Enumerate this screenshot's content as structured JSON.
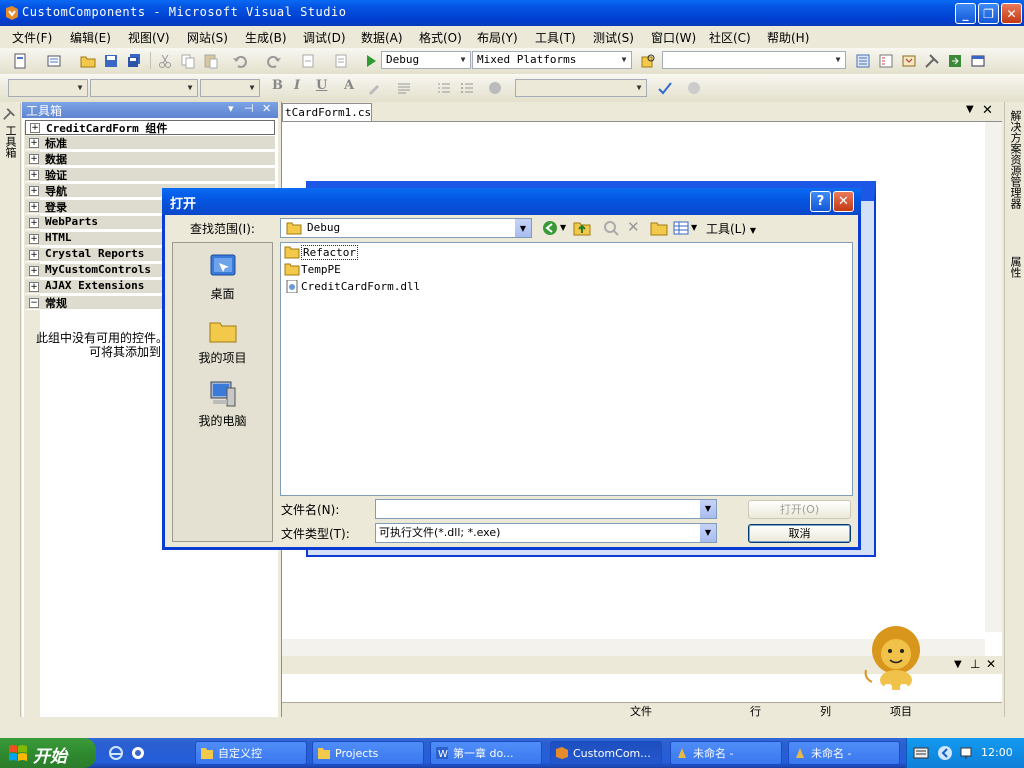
{
  "window": {
    "title": "CustomComponents - Microsoft Visual Studio"
  },
  "menu": [
    "文件(F)",
    "编辑(E)",
    "视图(V)",
    "网站(S)",
    "生成(B)",
    "调试(D)",
    "数据(A)",
    "格式(O)",
    "布局(Y)",
    "工具(T)",
    "测试(S)",
    "窗口(W)",
    "社区(C)",
    "帮助(H)"
  ],
  "toolbar": {
    "config": "Debug",
    "platform": "Mixed Platforms"
  },
  "toolbox": {
    "title": "工具箱",
    "side_tab": "工具箱",
    "groups": [
      {
        "label": "CreditCardForm 组件",
        "expanded": false
      },
      {
        "label": "标准",
        "expanded": false
      },
      {
        "label": "数据",
        "expanded": false
      },
      {
        "label": "验证",
        "expanded": false
      },
      {
        "label": "导航",
        "expanded": false
      },
      {
        "label": "登录",
        "expanded": false
      },
      {
        "label": "WebParts",
        "expanded": false
      },
      {
        "label": "HTML",
        "expanded": false
      },
      {
        "label": "Crystal Reports",
        "expanded": false
      },
      {
        "label": "MyCustomControls",
        "expanded": false
      },
      {
        "label": "AJAX Extensions",
        "expanded": false
      },
      {
        "label": "常规",
        "expanded": true
      }
    ],
    "empty_line1": "此组中没有可用的控件。",
    "empty_line2": "可将其添加到"
  },
  "editor": {
    "tab": "tCardForm1.cs"
  },
  "right_tabs": {
    "solution": "解决方案资源管理器",
    "properties": "属性"
  },
  "bottom_panel": {
    "columns": [
      "文件",
      "行",
      "列",
      "项目"
    ]
  },
  "dialog": {
    "title": "打开",
    "look_in_label": "查找范围(I):",
    "look_in_value": "Debug",
    "tools_label": "工具(L)",
    "places": [
      "桌面",
      "我的项目",
      "我的电脑"
    ],
    "files": [
      {
        "name": "Refactor",
        "type": "folder",
        "focused": true
      },
      {
        "name": "TempPE",
        "type": "folder",
        "focused": false
      },
      {
        "name": "CreditCardForm.dll",
        "type": "file",
        "focused": false
      }
    ],
    "filename_label": "文件名(N):",
    "filename_value": "",
    "filetype_label": "文件类型(T):",
    "filetype_value": "可执行文件(*.dll; *.exe)",
    "open_button": "打开(O)",
    "cancel_button": "取消"
  },
  "taskbar": {
    "start": "开始",
    "tasks": [
      "自定义控",
      "Projects",
      "第一章 do...",
      "CustomCom...",
      "未命名 -",
      "未命名 -"
    ],
    "active_task": 3,
    "clock": "12:00"
  },
  "colors": {
    "xp_blue": "#0a47c9",
    "start_green": "#2f8b2f",
    "toolbox_header": "#7ca3e6"
  }
}
